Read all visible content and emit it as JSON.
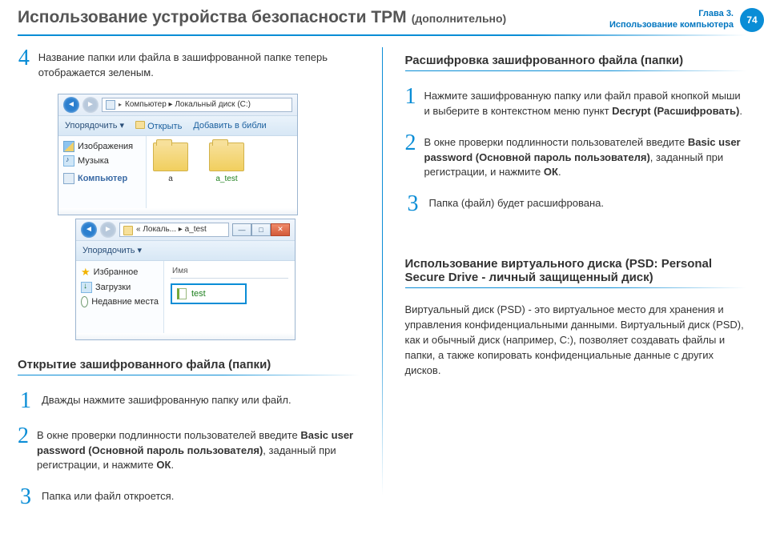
{
  "header": {
    "title": "Использование устройства безопасности TPM",
    "subtitle": "(дополнительно)",
    "chapter_line1": "Глава 3.",
    "chapter_line2": "Использование компьютера",
    "page_number": "74"
  },
  "left": {
    "step4": "Название папки или файла в зашифрованной папке теперь отображается зеленым.",
    "sectionA_heading": "Открытие зашифрованного файла (папки)",
    "stepA1": "Дважды нажмите зашифрованную папку или файл.",
    "stepA2_a": "В окне проверки подлинности пользователей введите ",
    "stepA2_b": "Basic user password (Основной пароль пользователя)",
    "stepA2_c": ", заданный при регистрации, и нажмите ",
    "stepA2_d": "ОК",
    "stepA2_e": ".",
    "stepA3": "Папка или файл откроется."
  },
  "right": {
    "sectionB_heading": "Расшифровка зашифрованного файла (папки)",
    "stepB1_a": "Нажмите зашифрованную папку или файл правой кнопкой мыши и выберите в контекстном меню пункт ",
    "stepB1_b": "Decrypt (Расшифровать)",
    "stepB1_c": ".",
    "stepB2_a": "В окне проверки подлинности пользователей введите ",
    "stepB2_b": "Basic user password (Основной пароль пользователя)",
    "stepB2_c": ", заданный при регистрации, и нажмите ",
    "stepB2_d": "ОК",
    "stepB2_e": ".",
    "stepB3": "Папка (файл) будет расшифрована.",
    "sectionC_heading": "Использование виртуального диска (PSD: Personal Secure Drive - личный защищенный диск)",
    "paraC": "Виртуальный диск (PSD) - это виртуальное место для хранения и управления конфиденциальными данными. Виртуальный диск (PSD), как и обычный диск (например, C:), позволяет создавать файлы и папки, а также копировать конфиденциальные данные с других дисков."
  },
  "explorer1": {
    "crumbs": "Компьютер  ▸  Локальный диск (C:)",
    "cmd_sort": "Упорядочить ▾",
    "cmd_open": "Открыть",
    "cmd_addlib": "Добавить в библи",
    "sb_images": "Изображения",
    "sb_music": "Музыка",
    "sb_computer": "Компьютер",
    "folder_a": "a",
    "folder_b": "a_test"
  },
  "explorer2": {
    "crumbs": "« Локаль...  ▸  a_test",
    "cmd_sort": "Упорядочить ▾",
    "sb_fav": "Избранное",
    "sb_dl": "Загрузки",
    "sb_recent": "Недавние места",
    "col_name": "Имя",
    "file": "test"
  }
}
